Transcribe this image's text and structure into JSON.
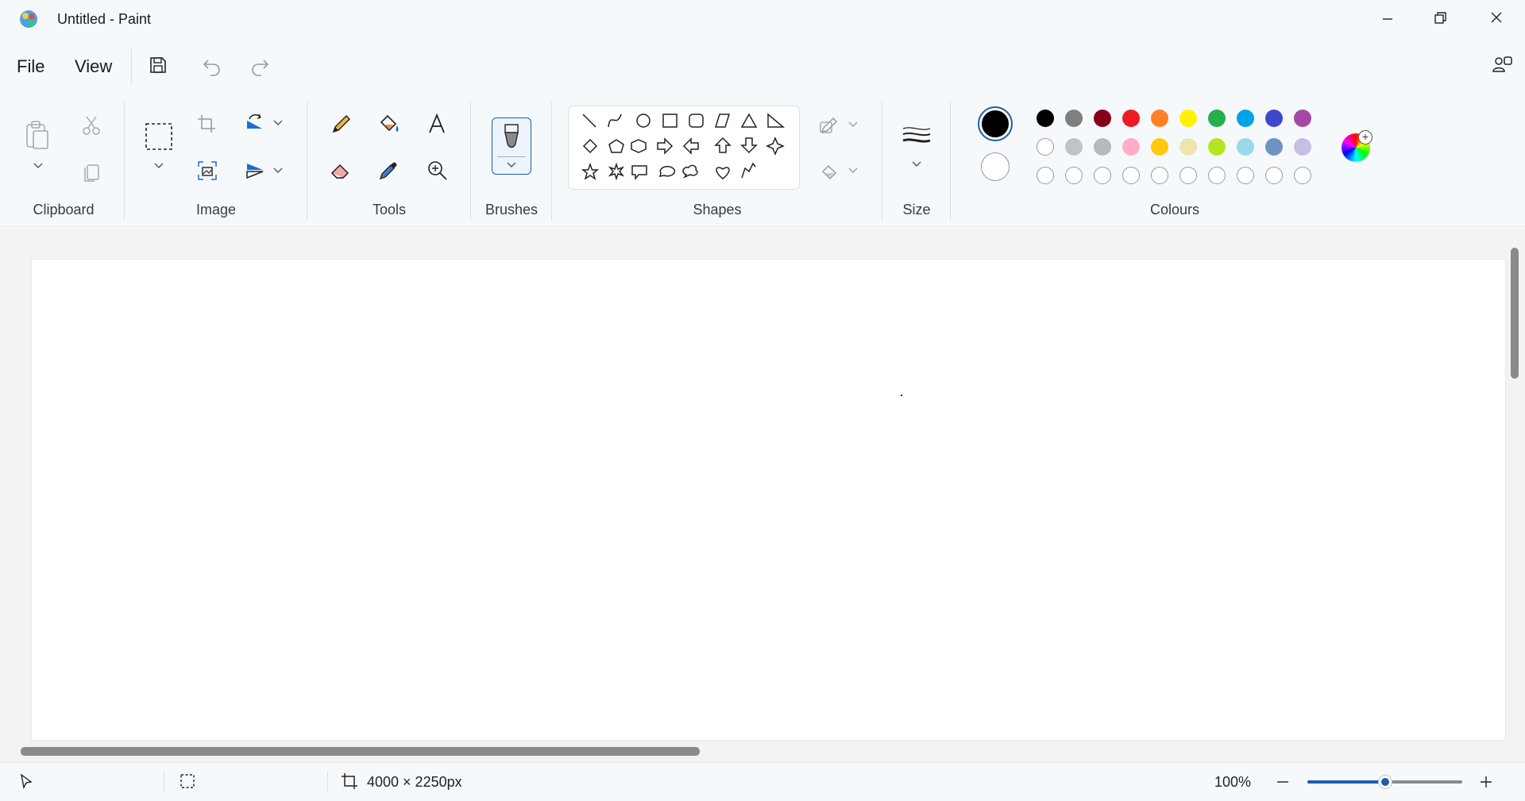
{
  "window": {
    "title": "Untitled - Paint"
  },
  "menu": {
    "file": "File",
    "view": "View"
  },
  "groups": {
    "clipboard": "Clipboard",
    "image": "Image",
    "tools": "Tools",
    "brushes": "Brushes",
    "shapes": "Shapes",
    "size": "Size",
    "colours": "Colours"
  },
  "colours": {
    "primary": "#000000",
    "secondary": "#ffffff",
    "row1": [
      "#000000",
      "#7f7f7f",
      "#880015",
      "#ed1c24",
      "#ff7f27",
      "#fff200",
      "#22b14c",
      "#00a2e8",
      "#3f48cc",
      "#a349a4"
    ],
    "row2": [
      "#ffffff",
      "#c3c3c3",
      "#b9b9b9",
      "#ffaec9",
      "#ffc90e",
      "#efe4b0",
      "#b5e61d",
      "#99d9ea",
      "#7092be",
      "#c8bfe7"
    ],
    "row3": [
      "",
      "",
      "",
      "",
      "",
      "",
      "",
      "",
      "",
      ""
    ]
  },
  "status": {
    "canvas_size": "4000 × 2250px",
    "zoom": "100%",
    "zoom_level": 0.5
  },
  "icons": {
    "app": "paint-app-icon",
    "save": "save-icon",
    "undo": "undo-icon",
    "redo": "redo-icon"
  }
}
